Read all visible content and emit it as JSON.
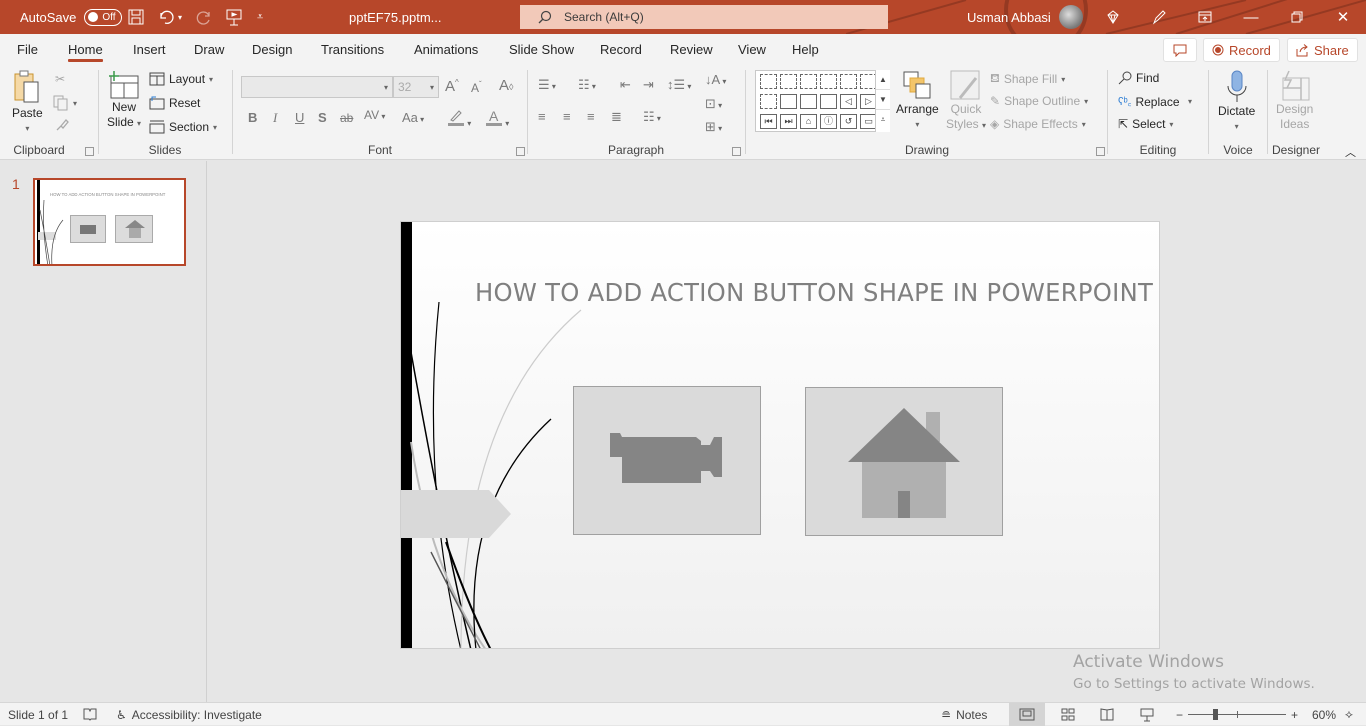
{
  "titlebar": {
    "autosave_label": "AutoSave",
    "autosave_state": "Off",
    "filename": "pptEF75.pptm...",
    "search_placeholder": "Search (Alt+Q)",
    "user_name": "Usman Abbasi",
    "accent": "#b7472a"
  },
  "menu": {
    "tabs": [
      "File",
      "Home",
      "Insert",
      "Draw",
      "Design",
      "Transitions",
      "Animations",
      "Slide Show",
      "Record",
      "Review",
      "View",
      "Help"
    ],
    "active_tab": "Home",
    "record_label": "Record",
    "share_label": "Share"
  },
  "ribbon": {
    "clipboard": {
      "label": "Clipboard",
      "paste": "Paste"
    },
    "slides": {
      "label": "Slides",
      "new_slide_1": "New",
      "new_slide_2": "Slide",
      "layout": "Layout",
      "reset": "Reset",
      "section": "Section"
    },
    "font": {
      "label": "Font",
      "font_name": "",
      "font_size": "32",
      "bold": "B",
      "italic": "I",
      "underline": "U",
      "shadow": "S",
      "strike": "ab",
      "spacing": "AV",
      "case": "Aa"
    },
    "paragraph": {
      "label": "Paragraph"
    },
    "drawing": {
      "label": "Drawing",
      "arrange": "Arrange",
      "quick_styles_1": "Quick",
      "quick_styles_2": "Styles",
      "shape_fill": "Shape Fill",
      "shape_outline": "Shape Outline",
      "shape_effects": "Shape Effects"
    },
    "editing": {
      "label": "Editing",
      "find": "Find",
      "replace": "Replace",
      "select": "Select"
    },
    "voice": {
      "label": "Voice",
      "dictate": "Dictate"
    },
    "designer": {
      "label": "Designer",
      "design_ideas_1": "Design",
      "design_ideas_2": "Ideas"
    }
  },
  "thumbnails": [
    {
      "number": "1",
      "title": "HOW TO ADD ACTION BUTTON SHAPE IN POWERPOINT",
      "selected": true
    }
  ],
  "slide": {
    "title": "HOW TO ADD ACTION BUTTON SHAPE IN POWERPOINT",
    "buttons": [
      {
        "type": "action-button-movie",
        "icon": "video-camera-icon"
      },
      {
        "type": "action-button-home",
        "icon": "home-icon"
      }
    ]
  },
  "watermark": {
    "line1": "Activate Windows",
    "line2": "Go to Settings to activate Windows."
  },
  "statusbar": {
    "slide_info": "Slide 1 of 1",
    "accessibility": "Accessibility: Investigate",
    "notes": "Notes",
    "zoom": "60%",
    "zoom_fraction": 0.6
  }
}
